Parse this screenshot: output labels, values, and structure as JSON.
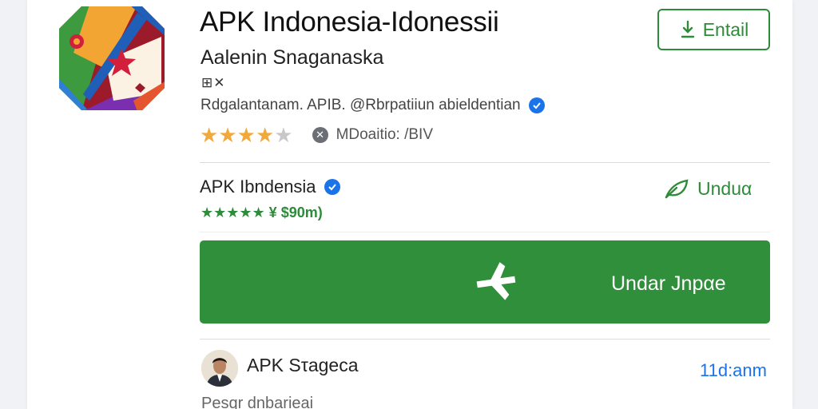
{
  "app": {
    "title": "APK Indonesia-Idonessii",
    "developer": "Aalenin Snaganaska",
    "tags": "⊞✕",
    "description": "Rdgalantanam. APIB. @Rbrpatiiun abieldentian",
    "rating": 4,
    "rating_max": 5,
    "rating_meta": "MDoaitio: /BIV",
    "install_button_label": "Entail"
  },
  "publisher": {
    "name": "APK Ibndensia",
    "rating_text": "★★★★★ ¥ $90m)",
    "download_label": "Unduα"
  },
  "primary_action": {
    "label": "Undar Jnpαe"
  },
  "review": {
    "reviewer": "APK Sτageca",
    "time": "11d:anm",
    "text": "Pesqr dnbarieai"
  },
  "colors": {
    "accent_green": "#2f8f3a",
    "link_blue": "#1a73e8",
    "star_gold": "#f2a93b"
  },
  "icons": [
    "app-logo-icon",
    "verified-icon",
    "close-badge-icon",
    "download-icon",
    "leaf-icon",
    "airplane-icon"
  ]
}
